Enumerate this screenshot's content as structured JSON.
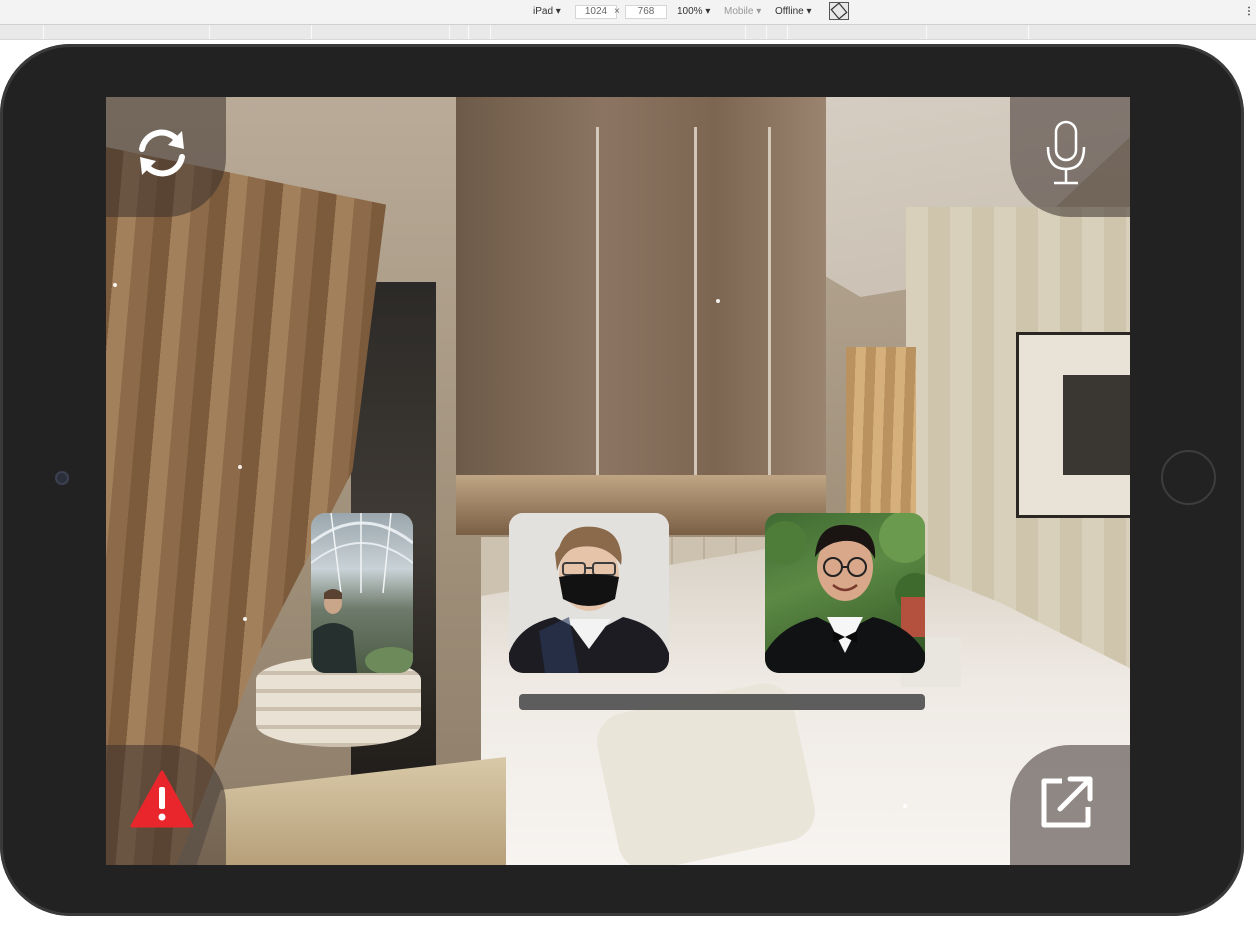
{
  "devtools": {
    "device": "iPad",
    "width": "1024",
    "times": "×",
    "height": "768",
    "zoom": "100%",
    "mode": "Mobile",
    "network": "Offline",
    "more": "⋮"
  },
  "controls": {
    "switch_icon": "refresh-cycle",
    "mic_icon": "microphone",
    "alert_icon": "warning-triangle",
    "alert_color": "#e8262b",
    "share_icon": "open-external"
  },
  "participants": [
    {
      "id": "p1",
      "depiction": "man in glass atrium"
    },
    {
      "id": "p2",
      "depiction": "person with black mask and glasses"
    },
    {
      "id": "p3",
      "depiction": "smiling man in tuxedo with glasses"
    }
  ],
  "volume": {
    "level": 1.0
  }
}
